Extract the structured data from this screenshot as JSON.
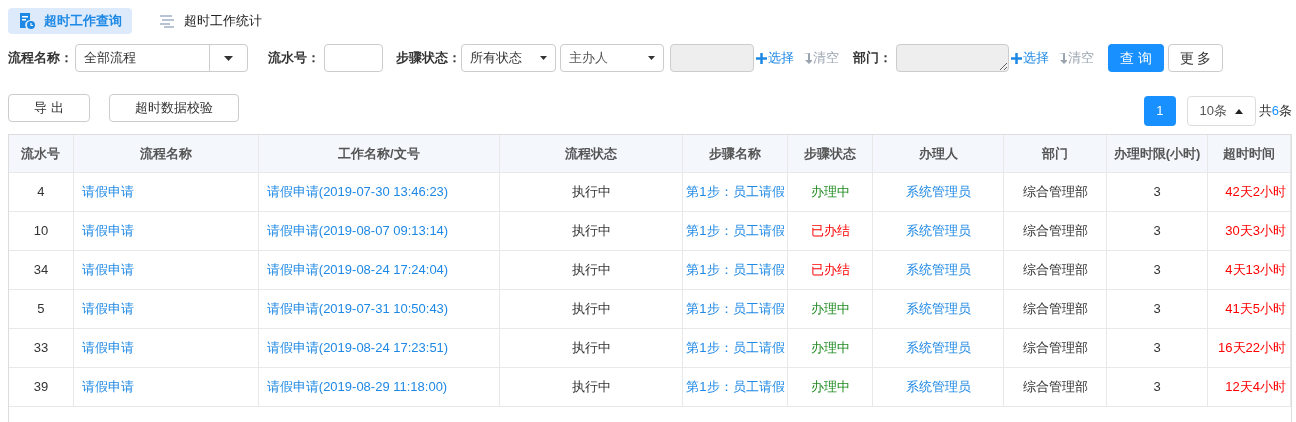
{
  "tabs": [
    {
      "label": "超时工作查询",
      "selected": true
    },
    {
      "label": "超时工作统计",
      "selected": false
    }
  ],
  "filters": {
    "flow_name": {
      "label": "流程名称：",
      "value": "全部流程"
    },
    "serial": {
      "label": "流水号："
    },
    "step_status": {
      "label": "步骤状态：",
      "value": "所有状态",
      "handler_value": "主办人",
      "select_link": "选择",
      "clear_link": "清空"
    },
    "department": {
      "label": "部门：",
      "select_link": "选择",
      "clear_link": "清空"
    },
    "query_button": "查 询",
    "more_button": "更 多"
  },
  "actions": [
    "导 出",
    "超时数据校验"
  ],
  "pagination": {
    "page": "1",
    "page_size": "10条",
    "total_prefix": "共",
    "total_count": "6",
    "total_suffix": "条"
  },
  "table": {
    "columns": [
      "流水号",
      "流程名称",
      "工作名称/文号",
      "流程状态",
      "步骤名称",
      "步骤状态",
      "办理人",
      "部门",
      "办理时限(小时)",
      "超时时间"
    ],
    "rows": [
      {
        "serial": "4",
        "flow": "请假申请",
        "work": "请假申请(2019-07-30 13:46:23)",
        "flow_status": "执行中",
        "step": "第1步：员工请假",
        "step_status": {
          "kind": "doing",
          "text": "办理中"
        },
        "handler": "系统管理员",
        "dept": "综合管理部",
        "limit": "3",
        "overtime": "42天2小时"
      },
      {
        "serial": "10",
        "flow": "请假申请",
        "work": "请假申请(2019-08-07 09:13:14)",
        "flow_status": "执行中",
        "step": "第1步：员工请假",
        "step_status": {
          "kind": "done",
          "text": "已办结"
        },
        "handler": "系统管理员",
        "dept": "综合管理部",
        "limit": "3",
        "overtime": "30天3小时"
      },
      {
        "serial": "34",
        "flow": "请假申请",
        "work": "请假申请(2019-08-24 17:24:04)",
        "flow_status": "执行中",
        "step": "第1步：员工请假",
        "step_status": {
          "kind": "done",
          "text": "已办结"
        },
        "handler": "系统管理员",
        "dept": "综合管理部",
        "limit": "3",
        "overtime": "4天13小时"
      },
      {
        "serial": "5",
        "flow": "请假申请",
        "work": "请假申请(2019-07-31 10:50:43)",
        "flow_status": "执行中",
        "step": "第1步：员工请假",
        "step_status": {
          "kind": "doing",
          "text": "办理中"
        },
        "handler": "系统管理员",
        "dept": "综合管理部",
        "limit": "3",
        "overtime": "41天5小时"
      },
      {
        "serial": "33",
        "flow": "请假申请",
        "work": "请假申请(2019-08-24 17:23:51)",
        "flow_status": "执行中",
        "step": "第1步：员工请假",
        "step_status": {
          "kind": "doing",
          "text": "办理中"
        },
        "handler": "系统管理员",
        "dept": "综合管理部",
        "limit": "3",
        "overtime": "16天22小时"
      },
      {
        "serial": "39",
        "flow": "请假申请",
        "work": "请假申请(2019-08-29 11:18:00)",
        "flow_status": "执行中",
        "step": "第1步：员工请假",
        "step_status": {
          "kind": "doing",
          "text": "办理中"
        },
        "handler": "系统管理员",
        "dept": "综合管理部",
        "limit": "3",
        "overtime": "12天4小时"
      }
    ]
  }
}
